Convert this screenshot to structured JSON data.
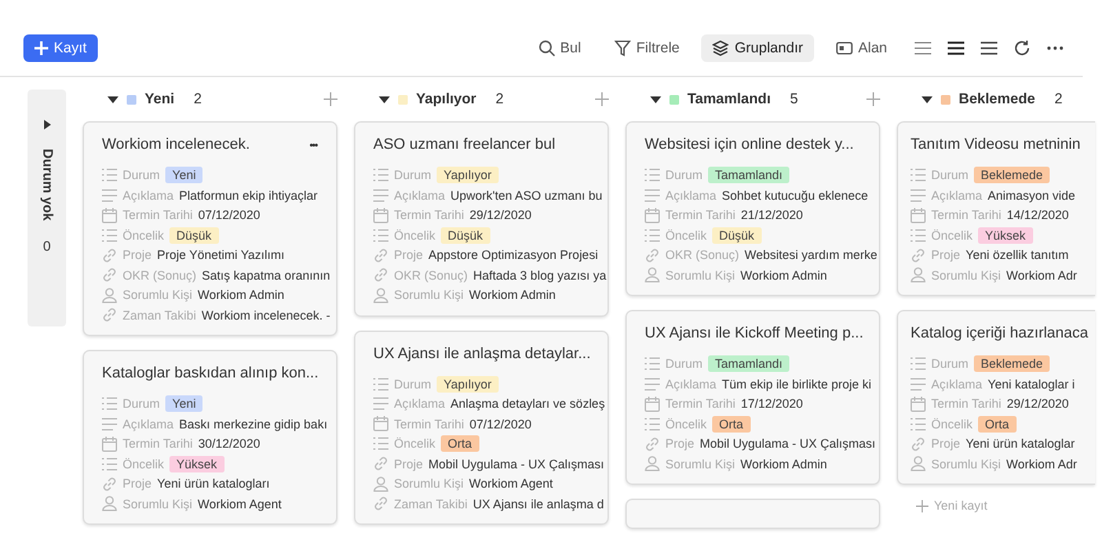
{
  "toolbar": {
    "add_button": "Kayıt",
    "tools": [
      {
        "kind": "search",
        "label": "Bul",
        "selected": false
      },
      {
        "kind": "filter",
        "label": "Filtrele",
        "selected": false
      },
      {
        "kind": "group",
        "label": "Gruplandır",
        "selected": true
      },
      {
        "kind": "field",
        "label": "Alan",
        "selected": false
      }
    ]
  },
  "collapsed_group": {
    "name": "Durum yok",
    "count": "0"
  },
  "columns": [
    {
      "name": "Yeni",
      "count": "2",
      "color": "#b7ccf7",
      "cards": [
        {
          "title": "Workiom incelenecek.",
          "menu": "•••",
          "fields": [
            {
              "kind": "status",
              "label": "Durum",
              "value": "Yeni",
              "color": "#c9d8fb"
            },
            {
              "kind": "text",
              "label": "Açıklama",
              "value": "Platformun ekip ihtiyaçlar"
            },
            {
              "kind": "date",
              "label": "Termin Tarihi",
              "value": "07/12/2020"
            },
            {
              "kind": "status",
              "label": "Öncelik",
              "value": "Düşük",
              "color": "#fcefc4"
            },
            {
              "kind": "link",
              "label": "Proje",
              "value": "Proje Yönetimi Yazılımı"
            },
            {
              "kind": "link",
              "label": "OKR (Sonuç)",
              "value": "Satış kapatma oranının"
            },
            {
              "kind": "person",
              "label": "Sorumlu Kişi",
              "value": "Workiom Admin"
            },
            {
              "kind": "link",
              "label": "Zaman Takibi",
              "value": "Workiom incelenecek. -"
            }
          ]
        },
        {
          "title": "Kataloglar baskıdan alınıp kon...",
          "fields": [
            {
              "kind": "status",
              "label": "Durum",
              "value": "Yeni",
              "color": "#c9d8fb"
            },
            {
              "kind": "text",
              "label": "Açıklama",
              "value": "Baskı merkezine gidip bakı"
            },
            {
              "kind": "date",
              "label": "Termin Tarihi",
              "value": "30/12/2020"
            },
            {
              "kind": "status",
              "label": "Öncelik",
              "value": "Yüksek",
              "color": "#fbcde0"
            },
            {
              "kind": "link",
              "label": "Proje",
              "value": "Yeni ürün katalogları"
            },
            {
              "kind": "person",
              "label": "Sorumlu Kişi",
              "value": "Workiom Agent"
            }
          ]
        }
      ]
    },
    {
      "name": "Yapılıyor",
      "count": "2",
      "color": "#fbefc4",
      "cards": [
        {
          "title": "ASO uzmanı freelancer bul",
          "fields": [
            {
              "kind": "status",
              "label": "Durum",
              "value": "Yapılıyor",
              "color": "#fcefc4"
            },
            {
              "kind": "text",
              "label": "Açıklama",
              "value": "Upwork'ten ASO uzmanı bu"
            },
            {
              "kind": "date",
              "label": "Termin Tarihi",
              "value": "29/12/2020"
            },
            {
              "kind": "status",
              "label": "Öncelik",
              "value": "Düşük",
              "color": "#fcefc4"
            },
            {
              "kind": "link",
              "label": "Proje",
              "value": "Appstore Optimizasyon Projesi"
            },
            {
              "kind": "link",
              "label": "OKR (Sonuç)",
              "value": "Haftada 3 blog yazısı ya"
            },
            {
              "kind": "person",
              "label": "Sorumlu Kişi",
              "value": "Workiom Admin"
            }
          ]
        },
        {
          "title": "UX Ajansı ile anlaşma detaylar...",
          "fields": [
            {
              "kind": "status",
              "label": "Durum",
              "value": "Yapılıyor",
              "color": "#fcefc4"
            },
            {
              "kind": "text",
              "label": "Açıklama",
              "value": "Anlaşma detayları ve sözleş"
            },
            {
              "kind": "date",
              "label": "Termin Tarihi",
              "value": "07/12/2020"
            },
            {
              "kind": "status",
              "label": "Öncelik",
              "value": "Orta",
              "color": "#fbc7a0"
            },
            {
              "kind": "link",
              "label": "Proje",
              "value": "Mobil Uygulama - UX Çalışması"
            },
            {
              "kind": "person",
              "label": "Sorumlu Kişi",
              "value": "Workiom Agent"
            },
            {
              "kind": "link",
              "label": "Zaman Takibi",
              "value": "UX Ajansı ile anlaşma d"
            }
          ]
        }
      ]
    },
    {
      "name": "Tamamlandı",
      "count": "5",
      "color": "#a6ecb8",
      "cards": [
        {
          "title": "Websitesi için online destek y...",
          "fields": [
            {
              "kind": "status",
              "label": "Durum",
              "value": "Tamamlandı",
              "color": "#bdf0cb"
            },
            {
              "kind": "text",
              "label": "Açıklama",
              "value": "Sohbet kutucuğu eklenece"
            },
            {
              "kind": "date",
              "label": "Termin Tarihi",
              "value": "21/12/2020"
            },
            {
              "kind": "status",
              "label": "Öncelik",
              "value": "Düşük",
              "color": "#fcefc4"
            },
            {
              "kind": "link",
              "label": "OKR (Sonuç)",
              "value": "Websitesi yardım merke"
            },
            {
              "kind": "person",
              "label": "Sorumlu Kişi",
              "value": "Workiom Admin"
            }
          ]
        },
        {
          "title": "UX Ajansı ile Kickoff Meeting p...",
          "fields": [
            {
              "kind": "status",
              "label": "Durum",
              "value": "Tamamlandı",
              "color": "#bdf0cb"
            },
            {
              "kind": "text",
              "label": "Açıklama",
              "value": "Tüm ekip ile birlikte proje ki"
            },
            {
              "kind": "date",
              "label": "Termin Tarihi",
              "value": "17/12/2020"
            },
            {
              "kind": "status",
              "label": "Öncelik",
              "value": "Orta",
              "color": "#fbc7a0"
            },
            {
              "kind": "link",
              "label": "Proje",
              "value": "Mobil Uygulama - UX Çalışması"
            },
            {
              "kind": "person",
              "label": "Sorumlu Kişi",
              "value": "Workiom Admin"
            }
          ]
        }
      ]
    },
    {
      "name": "Beklemede",
      "count": "2",
      "color": "#f8c39c",
      "cards": [
        {
          "title": "Tanıtım Videosu metninin",
          "fields": [
            {
              "kind": "status",
              "label": "Durum",
              "value": "Beklemede",
              "color": "#fbc7a0"
            },
            {
              "kind": "text",
              "label": "Açıklama",
              "value": "Animasyon vide"
            },
            {
              "kind": "date",
              "label": "Termin Tarihi",
              "value": "14/12/2020"
            },
            {
              "kind": "status",
              "label": "Öncelik",
              "value": "Yüksek",
              "color": "#fbcde0"
            },
            {
              "kind": "link",
              "label": "Proje",
              "value": "Yeni özellik tanıtım"
            },
            {
              "kind": "person",
              "label": "Sorumlu Kişi",
              "value": "Workiom Adr"
            }
          ]
        },
        {
          "title": "Katalog içeriği hazırlanaca",
          "fields": [
            {
              "kind": "status",
              "label": "Durum",
              "value": "Beklemede",
              "color": "#fbc7a0"
            },
            {
              "kind": "text",
              "label": "Açıklama",
              "value": "Yeni kataloglar i"
            },
            {
              "kind": "date",
              "label": "Termin Tarihi",
              "value": "29/12/2020"
            },
            {
              "kind": "status",
              "label": "Öncelik",
              "value": "Orta",
              "color": "#fbc7a0"
            },
            {
              "kind": "link",
              "label": "Proje",
              "value": "Yeni ürün kataloglar"
            },
            {
              "kind": "person",
              "label": "Sorumlu Kişi",
              "value": "Workiom Adr"
            }
          ]
        }
      ],
      "add_record": "Yeni kayıt"
    }
  ]
}
